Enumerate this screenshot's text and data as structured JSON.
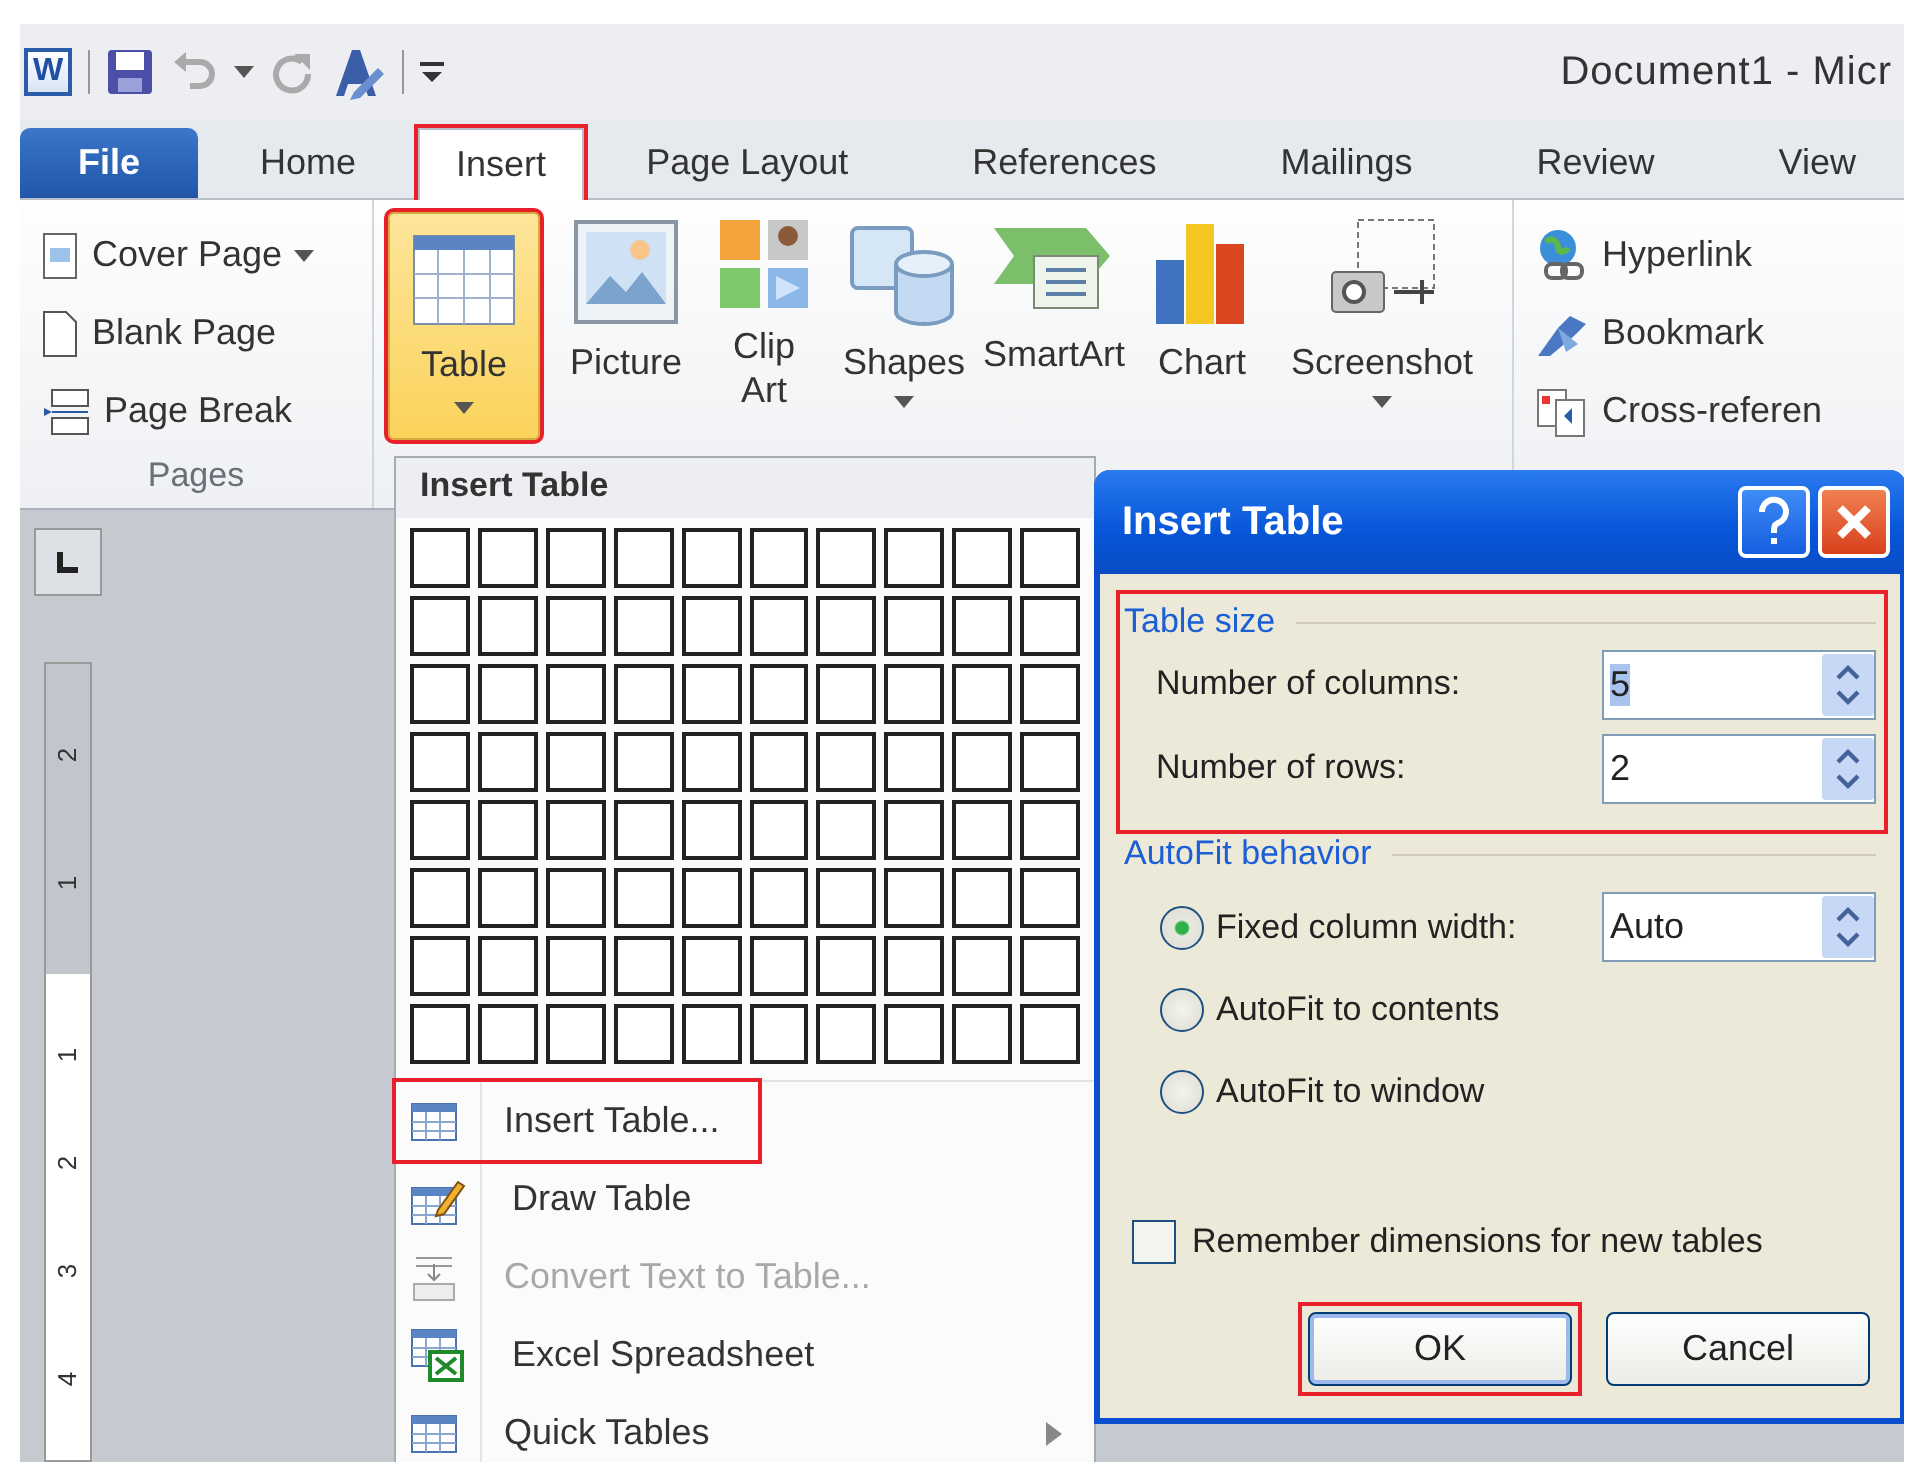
{
  "title_bar": {
    "logo": "W",
    "title": "Document1 - Micr"
  },
  "tabs": [
    {
      "label": "File",
      "kind": "file",
      "selected": false,
      "highlighted": false
    },
    {
      "label": "Home",
      "kind": "tab",
      "selected": false,
      "highlighted": false
    },
    {
      "label": "Insert",
      "kind": "tab",
      "selected": true,
      "highlighted": true
    },
    {
      "label": "Page Layout",
      "kind": "tab",
      "selected": false,
      "highlighted": false
    },
    {
      "label": "References",
      "kind": "tab",
      "selected": false,
      "highlighted": false
    },
    {
      "label": "Mailings",
      "kind": "tab",
      "selected": false,
      "highlighted": false
    },
    {
      "label": "Review",
      "kind": "tab",
      "selected": false,
      "highlighted": false
    },
    {
      "label": "View",
      "kind": "tab",
      "selected": false,
      "highlighted": false
    }
  ],
  "ribbon": {
    "pages": {
      "label": "Pages",
      "items": [
        {
          "label": "Cover Page",
          "kind": "cover",
          "dropdown": true
        },
        {
          "label": "Blank Page",
          "kind": "blank",
          "dropdown": false
        },
        {
          "label": "Page Break",
          "kind": "break",
          "dropdown": false
        }
      ]
    },
    "table_button": {
      "label": "Table",
      "highlighted": true
    },
    "illustrations": [
      {
        "label": "Picture",
        "kind": "picture",
        "dropdown": false
      },
      {
        "label": "Clip Art",
        "kind": "clipart",
        "dropdown": false
      },
      {
        "label": "Shapes",
        "kind": "shapes",
        "dropdown": true
      },
      {
        "label": "SmartArt",
        "kind": "smartart",
        "dropdown": false
      },
      {
        "label": "Chart",
        "kind": "chart",
        "dropdown": false
      },
      {
        "label": "Screenshot",
        "kind": "screenshot",
        "dropdown": true
      }
    ],
    "links": [
      {
        "label": "Hyperlink",
        "kind": "hyperlink"
      },
      {
        "label": "Bookmark",
        "kind": "bookmark"
      },
      {
        "label": "Cross-referen",
        "kind": "crossref"
      }
    ]
  },
  "ruler_marks": [
    {
      "label": "2",
      "kind": "margin"
    },
    {
      "label": "1",
      "kind": "margin"
    },
    {
      "label": "1",
      "kind": "page"
    },
    {
      "label": "2",
      "kind": "page"
    },
    {
      "label": "3",
      "kind": "page"
    },
    {
      "label": "4",
      "kind": "page"
    }
  ],
  "menu": {
    "header": "Insert Table",
    "grid": [
      {
        "cells": [
          {
            "selected": false
          },
          {
            "selected": false
          },
          {
            "selected": false
          },
          {
            "selected": false
          },
          {
            "selected": false
          },
          {
            "selected": false
          },
          {
            "selected": false
          },
          {
            "selected": false
          },
          {
            "selected": false
          },
          {
            "selected": false
          }
        ]
      },
      {
        "cells": [
          {
            "selected": false
          },
          {
            "selected": false
          },
          {
            "selected": false
          },
          {
            "selected": false
          },
          {
            "selected": false
          },
          {
            "selected": false
          },
          {
            "selected": false
          },
          {
            "selected": false
          },
          {
            "selected": false
          },
          {
            "selected": false
          }
        ]
      },
      {
        "cells": [
          {
            "selected": false
          },
          {
            "selected": false
          },
          {
            "selected": false
          },
          {
            "selected": false
          },
          {
            "selected": false
          },
          {
            "selected": false
          },
          {
            "selected": false
          },
          {
            "selected": false
          },
          {
            "selected": false
          },
          {
            "selected": false
          }
        ]
      },
      {
        "cells": [
          {
            "selected": false
          },
          {
            "selected": false
          },
          {
            "selected": false
          },
          {
            "selected": false
          },
          {
            "selected": false
          },
          {
            "selected": false
          },
          {
            "selected": false
          },
          {
            "selected": false
          },
          {
            "selected": false
          },
          {
            "selected": false
          }
        ]
      },
      {
        "cells": [
          {
            "selected": false
          },
          {
            "selected": false
          },
          {
            "selected": false
          },
          {
            "selected": false
          },
          {
            "selected": false
          },
          {
            "selected": false
          },
          {
            "selected": false
          },
          {
            "selected": false
          },
          {
            "selected": false
          },
          {
            "selected": false
          }
        ]
      },
      {
        "cells": [
          {
            "selected": false
          },
          {
            "selected": false
          },
          {
            "selected": false
          },
          {
            "selected": false
          },
          {
            "selected": false
          },
          {
            "selected": false
          },
          {
            "selected": false
          },
          {
            "selected": false
          },
          {
            "selected": false
          },
          {
            "selected": false
          }
        ]
      },
      {
        "cells": [
          {
            "selected": false
          },
          {
            "selected": false
          },
          {
            "selected": false
          },
          {
            "selected": false
          },
          {
            "selected": false
          },
          {
            "selected": false
          },
          {
            "selected": false
          },
          {
            "selected": false
          },
          {
            "selected": false
          },
          {
            "selected": false
          }
        ]
      },
      {
        "cells": [
          {
            "selected": false
          },
          {
            "selected": false
          },
          {
            "selected": false
          },
          {
            "selected": false
          },
          {
            "selected": false
          },
          {
            "selected": false
          },
          {
            "selected": false
          },
          {
            "selected": false
          },
          {
            "selected": false
          },
          {
            "selected": false
          }
        ]
      }
    ],
    "items": [
      {
        "label": "Insert Table...",
        "kind": "insert",
        "disabled": false,
        "highlighted": true,
        "submenu": false
      },
      {
        "label": "Draw Table",
        "kind": "draw",
        "disabled": false,
        "highlighted": false,
        "submenu": false
      },
      {
        "label": "Convert Text to Table...",
        "kind": "convert",
        "disabled": true,
        "highlighted": false,
        "submenu": false
      },
      {
        "label": "Excel Spreadsheet",
        "kind": "excel",
        "disabled": false,
        "highlighted": false,
        "submenu": false
      },
      {
        "label": "Quick Tables",
        "kind": "quick",
        "disabled": false,
        "highlighted": false,
        "submenu": true
      }
    ]
  },
  "dialog": {
    "title": "Insert Table",
    "table_size": {
      "label": "Table size",
      "highlighted": true,
      "fields": [
        {
          "label": "Number of columns:",
          "value": "5",
          "text_selected": true
        },
        {
          "label": "Number of rows:",
          "value": "2",
          "text_selected": false
        }
      ]
    },
    "autofit": {
      "label": "AutoFit behavior",
      "options": [
        {
          "label": "Fixed column width:",
          "selected": true,
          "value": "Auto"
        },
        {
          "label": "AutoFit to contents",
          "selected": false
        },
        {
          "label": "AutoFit to window",
          "selected": false
        }
      ]
    },
    "remember": {
      "label": "Remember dimensions for new tables",
      "checked": false
    },
    "buttons": [
      {
        "label": "OK",
        "kind": "default",
        "highlighted": true
      },
      {
        "label": "Cancel",
        "kind": "normal",
        "highlighted": false
      }
    ]
  }
}
